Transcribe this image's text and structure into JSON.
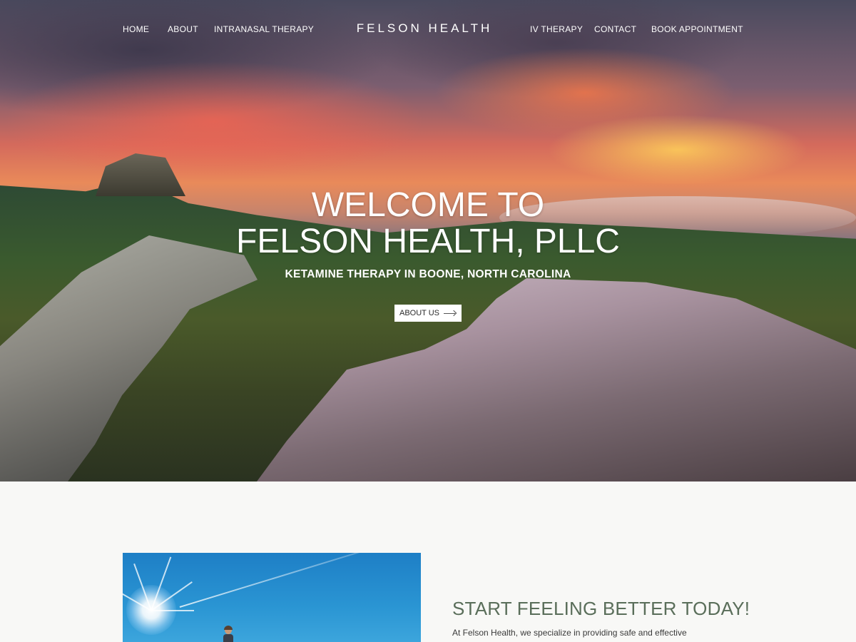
{
  "nav": {
    "left": [
      "HOME",
      "ABOUT",
      "INTRANASAL THERAPY"
    ],
    "brand": "FELSON HEALTH",
    "right": [
      "IV THERAPY",
      "CONTACT",
      "BOOK APPOINTMENT"
    ]
  },
  "hero": {
    "title_line1": "WELCOME TO",
    "title_line2": "FELSON HEALTH, PLLC",
    "subtitle": "KETAMINE THERAPY IN BOONE, NORTH CAROLINA",
    "button_label": "ABOUT US",
    "button_icon": "arrow-right-icon"
  },
  "intro": {
    "heading": "START FEELING BETTER TODAY!",
    "text": "At Felson Health, we specialize in providing safe and effective"
  },
  "colors": {
    "heading_green": "#5a6e5a",
    "page_background": "#f8f8f6",
    "button_background": "#ffffff"
  }
}
